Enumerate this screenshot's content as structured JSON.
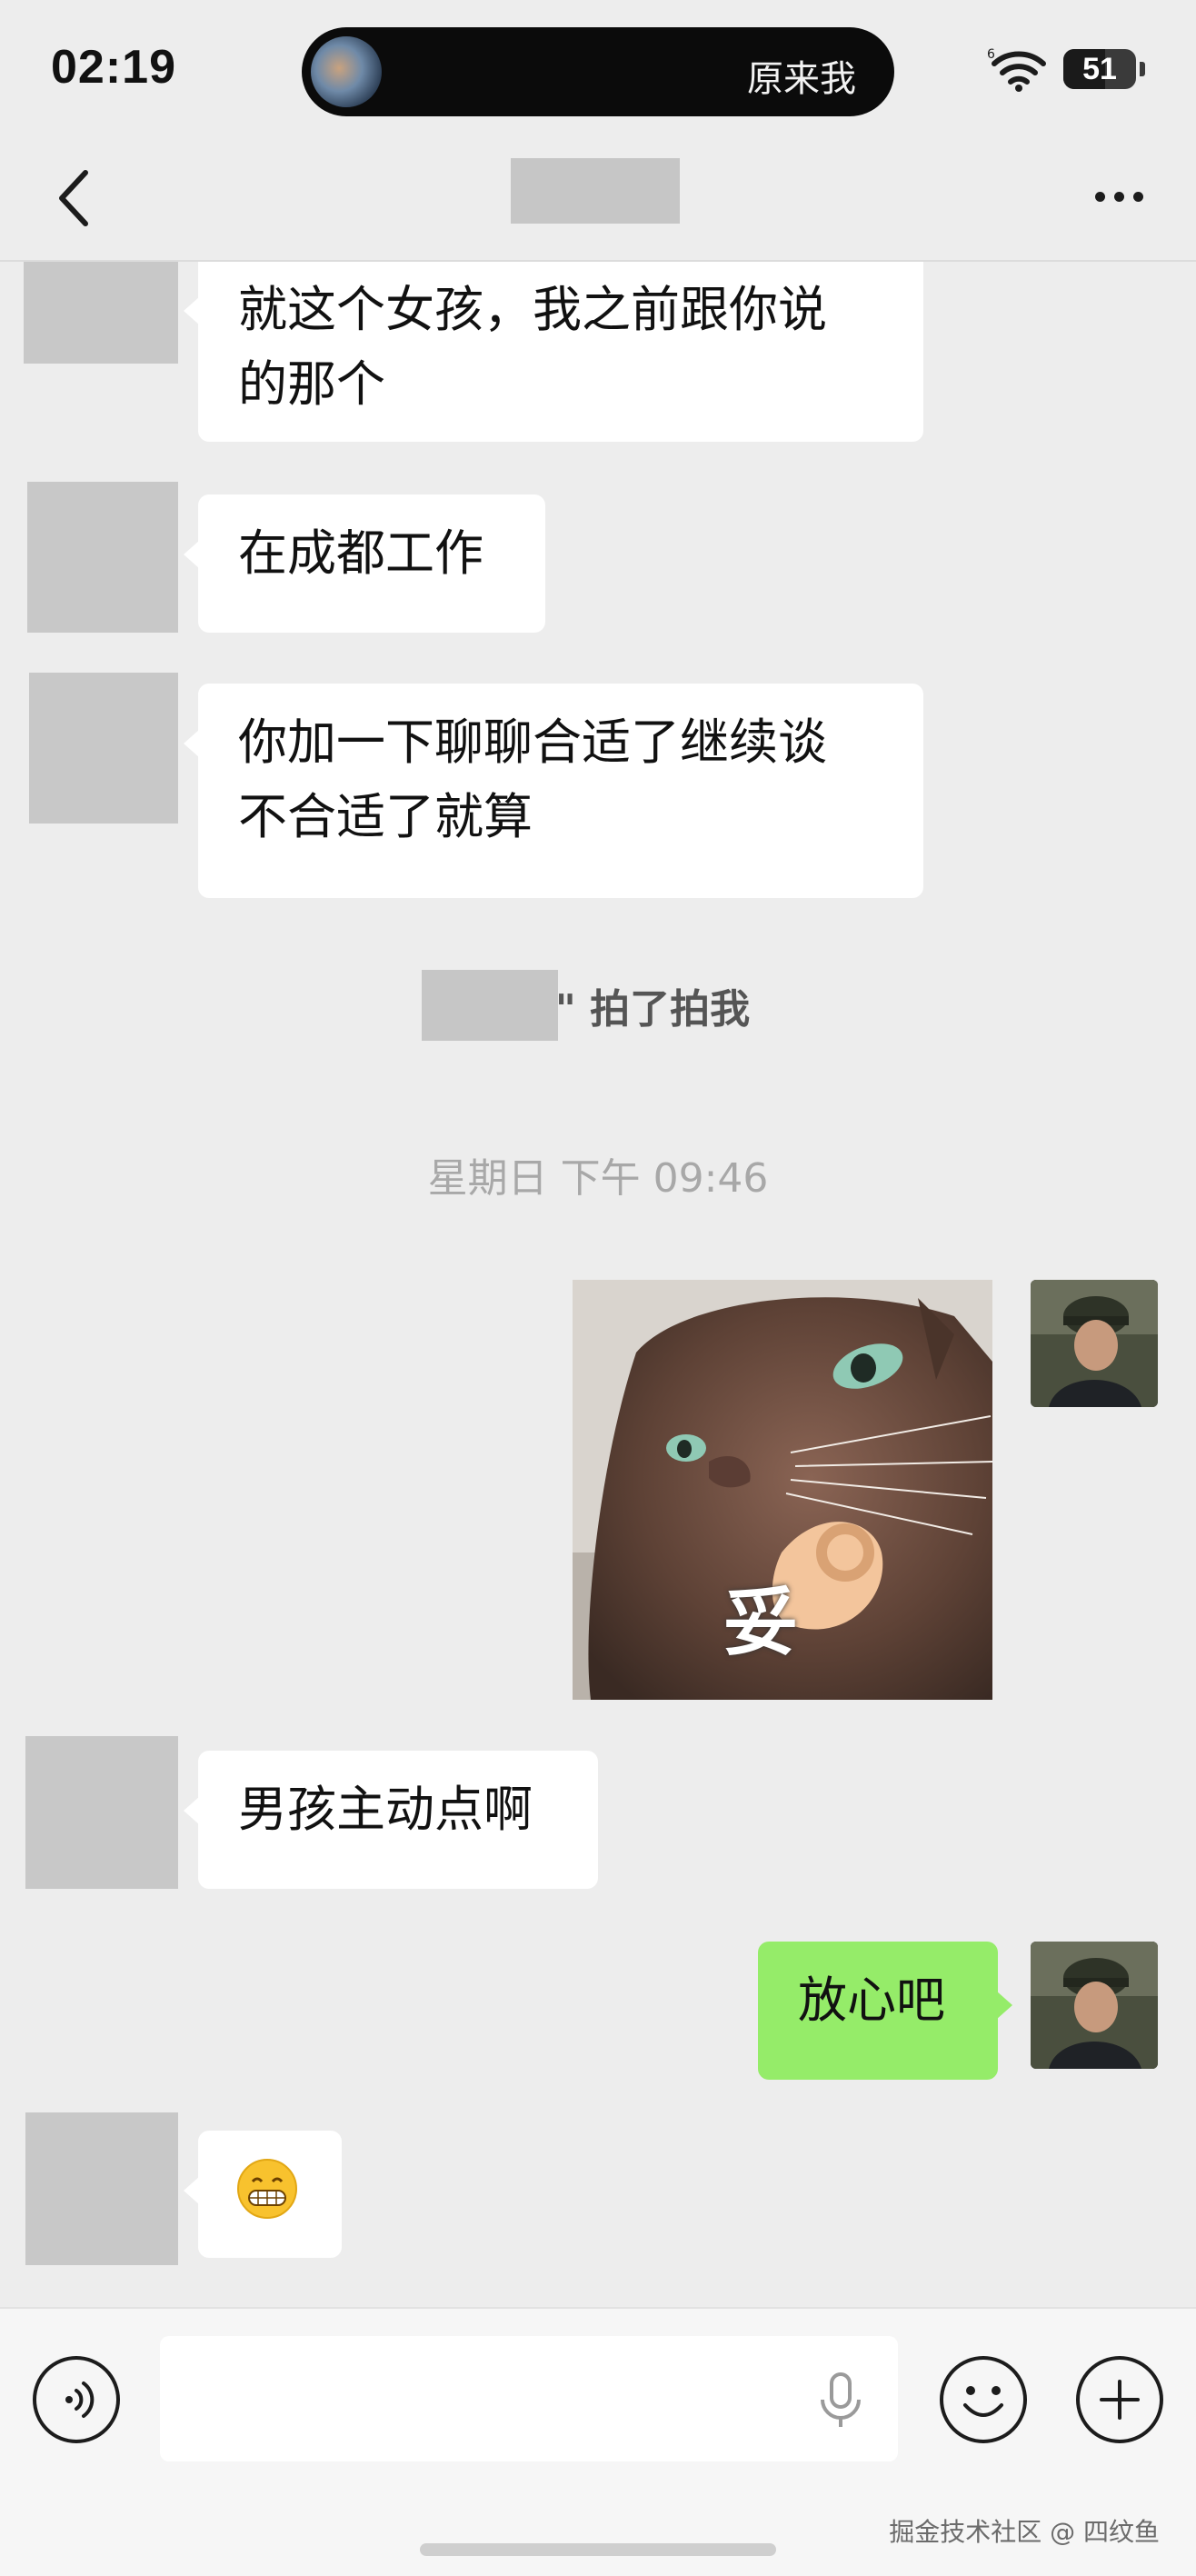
{
  "status_bar": {
    "time": "02:19",
    "live_activity_text": "原来我",
    "battery_level": "51"
  },
  "nav": {
    "back_icon": "chevron-left-icon",
    "more_icon": "more-dots-icon"
  },
  "messages": [
    {
      "side": "left",
      "text_lines": [
        "就这个女孩，我之前跟你说",
        "的那个"
      ]
    },
    {
      "side": "left",
      "text": "在成都工作"
    },
    {
      "side": "left",
      "text_lines": [
        "你加一下聊聊合适了继续谈",
        "不合适了就算"
      ]
    },
    {
      "side": "right",
      "type": "sticker",
      "caption": "妥"
    },
    {
      "side": "left",
      "text": "男孩主动点啊"
    },
    {
      "side": "right",
      "text": "放心吧"
    },
    {
      "side": "left",
      "emoji": "😁"
    }
  ],
  "system": {
    "pat_text": "\" 拍了拍我",
    "timestamp": "星期日 下午 09:46"
  },
  "input_bar": {
    "voice_icon": "voice-mode-icon",
    "mic_icon": "microphone-icon",
    "emoji_icon": "emoji-smile-icon",
    "plus_icon": "plus-icon",
    "value": ""
  },
  "watermark": "掘金技术社区 @ 四纹鱼",
  "colors": {
    "background": "#ededed",
    "bubble_self": "#95ec69",
    "bubble_other": "#ffffff",
    "avatar_placeholder": "#c8c8c8"
  }
}
